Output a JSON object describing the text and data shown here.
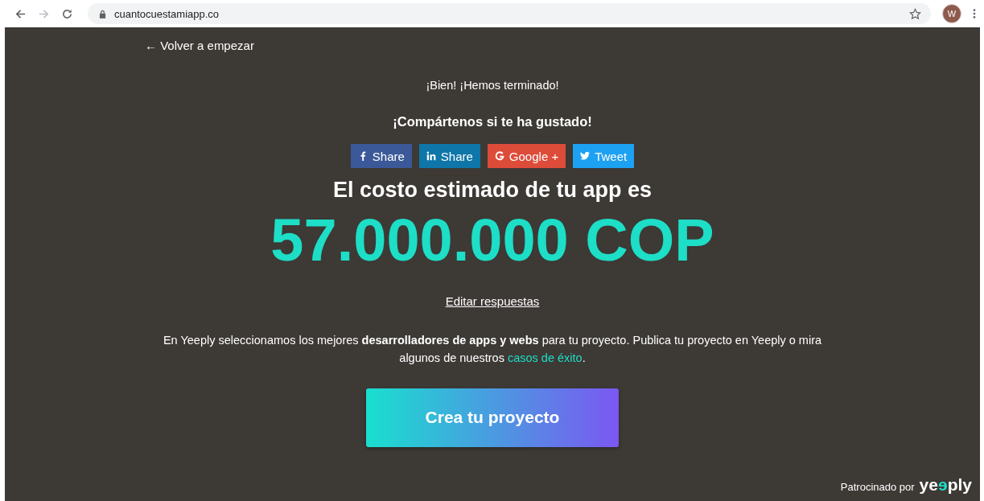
{
  "browser": {
    "url": "cuantocuestamiapp.co",
    "avatar": "W"
  },
  "back_link": "← Volver a empezar",
  "finished": "¡Bien! ¡Hemos terminado!",
  "share_prompt": "¡Compártenos si te ha gustado!",
  "share_buttons": [
    {
      "kind": "facebook",
      "label": "Share",
      "color": "#3b5998"
    },
    {
      "kind": "linkedin",
      "label": "Share",
      "color": "#0e76a8"
    },
    {
      "kind": "google",
      "label": "Google +",
      "color": "#dd4b39"
    },
    {
      "kind": "twitter",
      "label": "Tweet",
      "color": "#1da1f2"
    }
  ],
  "estimate_title": "El costo estimado de tu app es",
  "estimate_value": "57.000.000 COP",
  "edit_link": "Editar respuestas",
  "description": {
    "text": "En Yeeply seleccionamos los mejores **desarrolladores de apps y webs** para tu proyecto. Publica tu proyecto en Yeeply o mira algunos de nuestros",
    "link": "casos de éxito",
    "end": "."
  },
  "cta_button": "Crea tu proyecto",
  "sponsor": {
    "label": "Patrocinado por",
    "logo_start": "ye",
    "logo_accent": "ɘ",
    "logo_end": "ply"
  }
}
